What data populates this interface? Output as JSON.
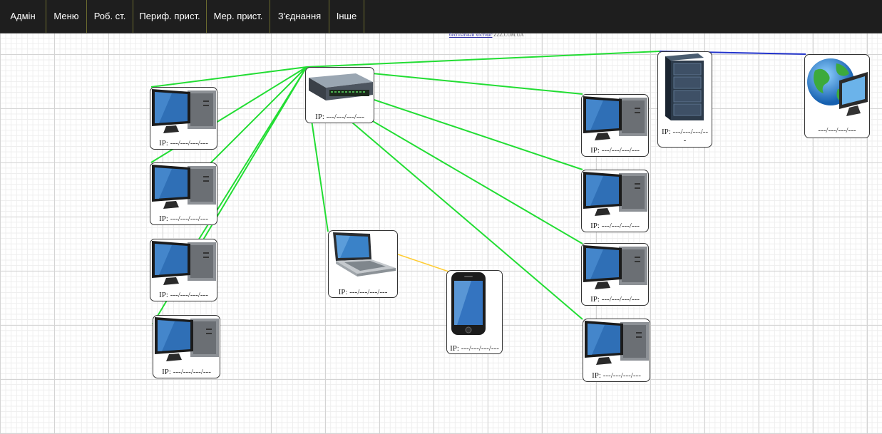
{
  "nav": {
    "items": [
      {
        "label": "Адмін"
      },
      {
        "label": "Меню"
      },
      {
        "label": "Роб. ст."
      },
      {
        "label": "Периф. прист."
      },
      {
        "label": "Мер. прист."
      },
      {
        "label": "З'єднання"
      },
      {
        "label": "Інше"
      }
    ]
  },
  "banner": {
    "link_text": "бесплатный хостинг",
    "text": "ZZZ.COM.UA"
  },
  "devices": {
    "switch": {
      "ip": "IP: ---/---/---/---"
    },
    "server": {
      "ip_line1": "IP: ---/---/---/--",
      "ip_line2": "-"
    },
    "internet": {
      "ip": "---/---/---/---"
    },
    "pc_left_1": {
      "ip": "IP: ---/---/---/---"
    },
    "pc_left_2": {
      "ip": "IP: ---/---/---/---"
    },
    "pc_left_3": {
      "ip": "IP: ---/---/---/---"
    },
    "pc_left_4": {
      "ip": "IP: ---/---/---/---"
    },
    "laptop": {
      "ip": "IP: ---/---/---/---"
    },
    "phone": {
      "ip": "IP: ---/---/---/---"
    },
    "pc_right_1": {
      "ip": "IP: ---/---/---/---"
    },
    "pc_right_2": {
      "ip": "IP: ---/---/---/---"
    },
    "pc_right_3": {
      "ip": "IP: ---/---/---/---"
    },
    "pc_right_4": {
      "ip": "IP: ---/---/---/---"
    }
  },
  "colors": {
    "ethernet_link": "#22dd33",
    "wan_link": "#2233cc",
    "wifi_link": "#ffcc33",
    "navbar_bg": "#1e1e1e"
  }
}
